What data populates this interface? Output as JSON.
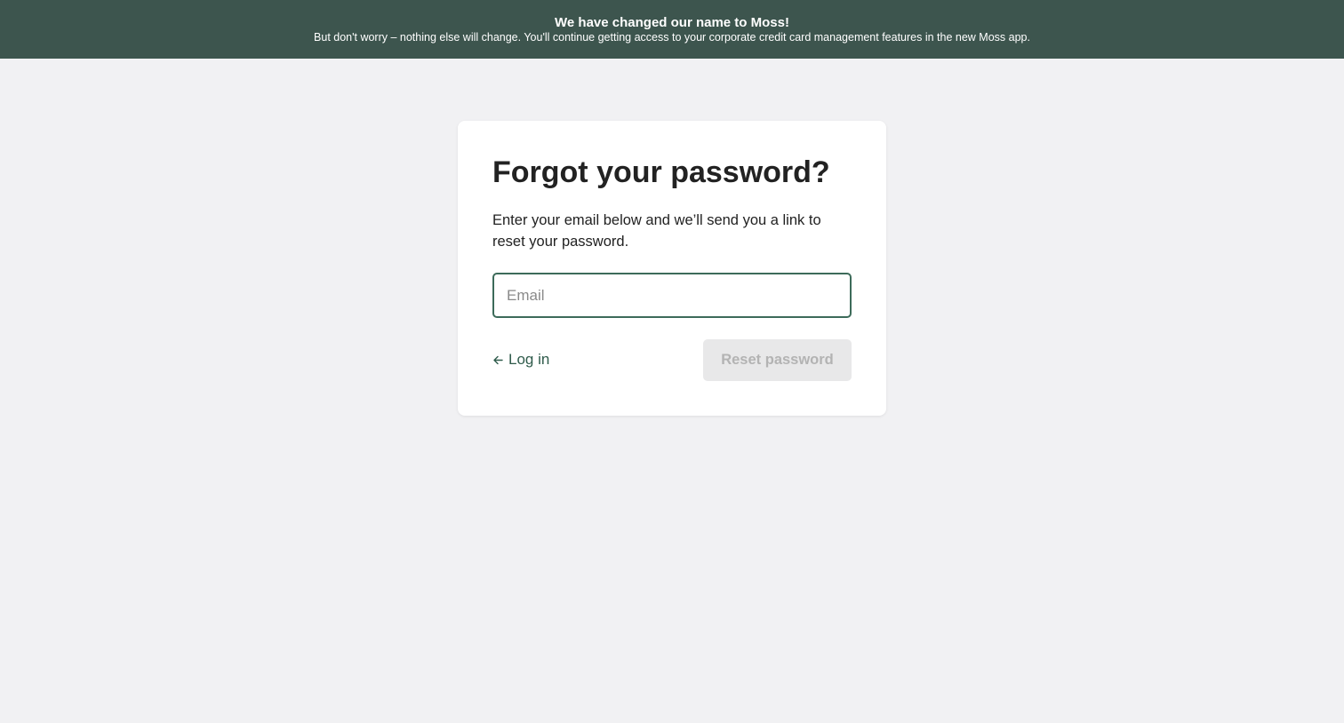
{
  "banner": {
    "title": "We have changed our name to Moss!",
    "text": "But don't worry – nothing else will change. You'll continue getting access to your corporate credit card management features in the new Moss app."
  },
  "card": {
    "title": "Forgot your password?",
    "description": "Enter your email below and we’ll send you a link to reset your password.",
    "email_placeholder": "Email",
    "email_value": "",
    "login_label": "Log in",
    "login_icon": "arrow-left-icon",
    "reset_label": "Reset password",
    "reset_disabled": true
  },
  "colors": {
    "banner_bg": "#3d554e",
    "page_bg": "#f1f1f3",
    "accent": "#2f5b4b",
    "input_border": "#3d6b5a",
    "button_disabled_bg": "#e8e8e9",
    "button_disabled_text": "#b3b3b3"
  }
}
